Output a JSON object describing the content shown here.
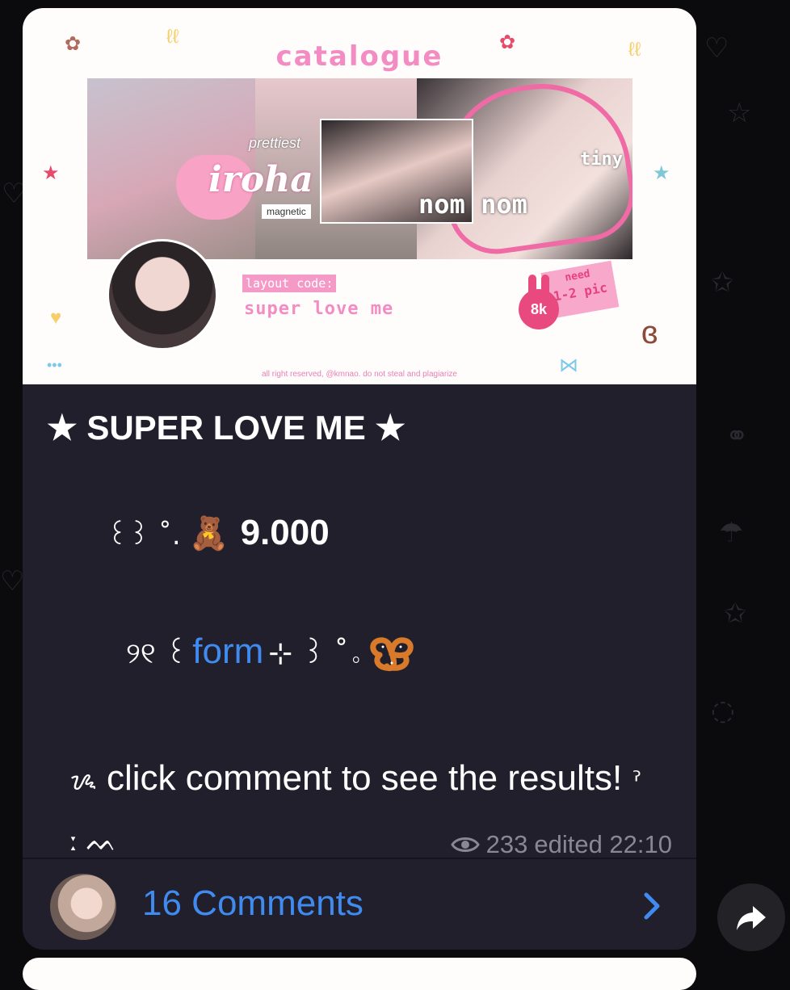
{
  "banner": {
    "title": "catalogue",
    "overlay_word_prettiest": "prettiest",
    "name": "iroha",
    "tag_magnetic": "magnetic",
    "nom": "nom nom",
    "tiny": "tiny",
    "layout_code_label": "layout code:",
    "layout_code_value": "super love me",
    "need_text": "need",
    "pic_range": "1-2 pic",
    "bunny_badge": "8k",
    "copyright": "all right reserved, @kmnao. do not steal and plagiarize"
  },
  "post": {
    "title": "★ SUPER LOVE ME ★",
    "price_glyph": "꒰꒱ ˚.",
    "price_icon": "teddy-bear-emoji",
    "price_value": "9.000",
    "form_prefix": "୨୧ ꒰",
    "form_link": "form",
    "form_suffix": "⊹ ꒱ ˚｡",
    "form_icon": "pretzel-emoji",
    "click_glyph": "ᝰ",
    "click_text": "click comment to see the results!",
    "click_tail": "ˀ  ː ᨓ",
    "views": "233",
    "edited": "edited 22:10"
  },
  "comments": {
    "label": "16 Comments"
  },
  "colors": {
    "bubble_bg": "#221f2c",
    "link_blue": "#3f8bf0",
    "accent_pink": "#f48cc4"
  }
}
